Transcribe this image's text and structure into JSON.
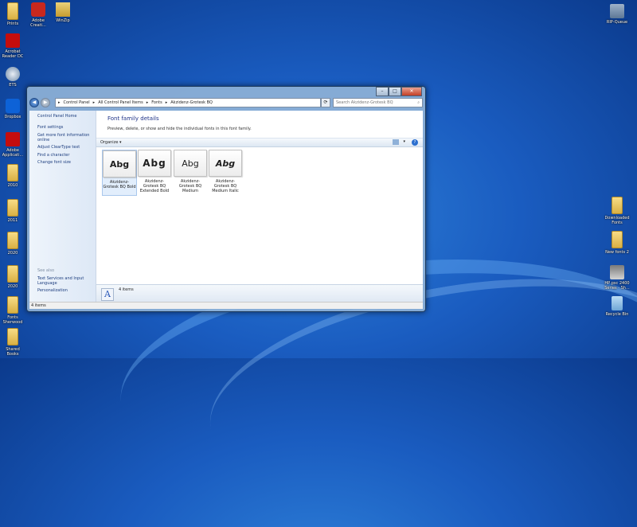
{
  "desktop": {
    "left_icons": [
      {
        "label": "Prints",
        "type": "folder"
      },
      {
        "label": "Acrobat Reader DC",
        "type": "pdf"
      },
      {
        "label": "ETS",
        "type": "ets"
      },
      {
        "label": "Dropbox",
        "type": "drop"
      },
      {
        "label": "Adobe Applicati...",
        "type": "pdf"
      },
      {
        "label": "2010",
        "type": "folder"
      },
      {
        "label": "2011",
        "type": "folder"
      },
      {
        "label": "2020",
        "type": "folder"
      },
      {
        "label": "2020",
        "type": "folder"
      },
      {
        "label": "Fonts Sherwood",
        "type": "folder"
      },
      {
        "label": "Shared Books",
        "type": "folder"
      }
    ],
    "top_icons": [
      {
        "label": "Adobe Creati...",
        "type": "cc"
      },
      {
        "label": "WinZip",
        "type": "zip"
      }
    ],
    "right_icons": [
      {
        "label": "RIP-Queue",
        "type": "rip"
      },
      {
        "label": "Downloaded Fonts",
        "type": "folder"
      },
      {
        "label": "New fonts 2",
        "type": "folder"
      },
      {
        "label": "HP psc 2400 Series - Sh...",
        "type": "printer"
      },
      {
        "label": "Recycle Bin",
        "type": "bin"
      }
    ]
  },
  "window": {
    "title_buttons": {
      "minimize": "–",
      "maximize": "□",
      "close": "✕"
    },
    "nav": {
      "back": "◀",
      "forward": "▶"
    },
    "address": {
      "segments": [
        "▸",
        "Control Panel",
        "▸",
        "All Control Panel Items",
        "▸",
        "Fonts",
        "▸",
        "Akzidenz-Grotesk BQ"
      ]
    },
    "search_placeholder": "Search Akzidenz-Grotesk BQ",
    "sidebar": {
      "links": [
        "Control Panel Home",
        "Font settings",
        "Get more font information online",
        "Adjust ClearType text",
        "Find a character",
        "Change font size"
      ],
      "see_also_label": "See also",
      "see_also_links": [
        "Text Services and Input Language",
        "Personalization"
      ]
    },
    "main": {
      "header": "Font family details",
      "description": "Preview, delete, or show and hide the individual fonts in this font family.",
      "organize_label": "Organize ▾",
      "fonts": [
        {
          "sample": "Abg",
          "name": "Akzidenz-Grotesk BQ Bold",
          "style": "bold"
        },
        {
          "sample": "Abg",
          "name": "Akzidenz-Grotesk BQ Extended Bold",
          "style": "extbold"
        },
        {
          "sample": "Abg",
          "name": "Akzidenz-Grotesk BQ Medium",
          "style": "medium"
        },
        {
          "sample": "Abg",
          "name": "Akzidenz-Grotesk BQ Medium Italic",
          "style": "italic"
        }
      ],
      "detail_icon_letter": "A",
      "item_count": "4 items"
    },
    "status_text": "4 items"
  }
}
